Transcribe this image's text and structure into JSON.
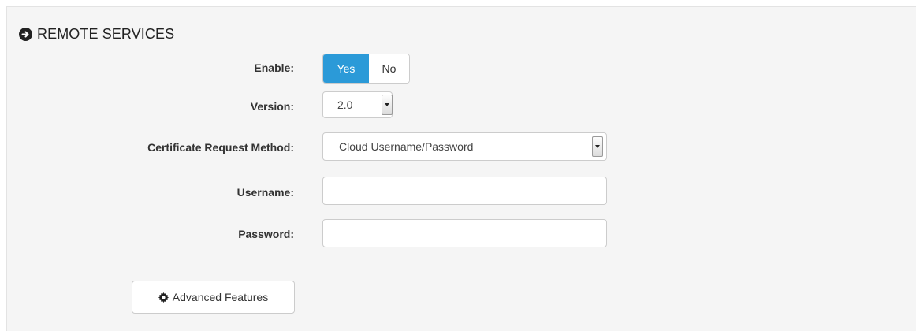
{
  "section": {
    "title": "REMOTE SERVICES",
    "icon": "circle-arrow-right-icon"
  },
  "enable": {
    "label": "Enable:",
    "options": [
      "Yes",
      "No"
    ],
    "selected": "Yes",
    "active_color": "#2b9ad8"
  },
  "version": {
    "label": "Version:",
    "value": "2.0"
  },
  "cert_method": {
    "label": "Certificate Request Method:",
    "value": "Cloud Username/Password"
  },
  "username": {
    "label": "Username:",
    "value": ""
  },
  "password": {
    "label": "Password:",
    "value": ""
  },
  "advanced": {
    "label": "Advanced Features",
    "icon": "gear-icon"
  }
}
